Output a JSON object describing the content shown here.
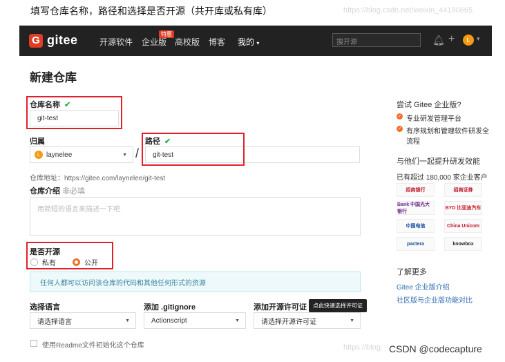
{
  "caption": "填写仓库名称，路径和选择是否开源（共开库或私有库）",
  "caption_watermark": "https://blog.csdn.net/weixin_44190665",
  "nav": {
    "brand": "gitee",
    "items": [
      "开源软件",
      "企业版",
      "高校版",
      "博客",
      "我的"
    ],
    "badge": "特惠",
    "search_placeholder": "搜开源",
    "avatar_letter": "L"
  },
  "page": {
    "title": "新建仓库",
    "repo_name_label": "仓库名称",
    "repo_name_value": "git-test",
    "owner_label": "归属",
    "owner_value": "laynelee",
    "path_label": "路径",
    "path_value": "git-test",
    "separator": "/",
    "repo_address": "仓库地址：https://gitee.com/laynelee/git-test",
    "intro_label": "仓库介绍",
    "intro_optional": "非必填",
    "intro_placeholder": "用简短的语言来描述一下吧",
    "open_label": "是否开源",
    "radio_private": "私有",
    "radio_public": "公开",
    "notice": "任何人都可以访问该仓库的代码和其他任何形式的资源",
    "lang_label": "选择语言",
    "lang_value": "请选择语言",
    "gitignore_label": "添加 .gitignore",
    "gitignore_value": "Actionscript",
    "license_label": "添加开源许可证",
    "license_value": "请选择开源许可证",
    "license_tooltip": "点此快速选择许可证",
    "readme_label": "使用Readme文件初始化这个仓库"
  },
  "side": {
    "try_title": "尝试 Gitee 企业版?",
    "features": [
      "专业研发管理平台",
      "有序规划和管理软件研发全流程"
    ],
    "together_title": "与他们一起提升研发效能",
    "customers": "已有超过 180,000 家企业客户",
    "logos": [
      "招商银行",
      "招商证券",
      "Bank 中国光大银行",
      "BYD 比亚迪汽车",
      "中国电信",
      "China Unicom",
      "pactera",
      "knowbox"
    ],
    "learn_more": "了解更多",
    "links": [
      "Gitee 企业版介绍",
      "社区版与企业版功能对比"
    ]
  },
  "footer": {
    "watermark": "https://blog.",
    "csdn": "CSDN @codecapture"
  },
  "colors": {
    "accent": "#f17028",
    "brand": "#e03d26",
    "highlight": "#e2202a",
    "link": "#2f6bb0"
  }
}
